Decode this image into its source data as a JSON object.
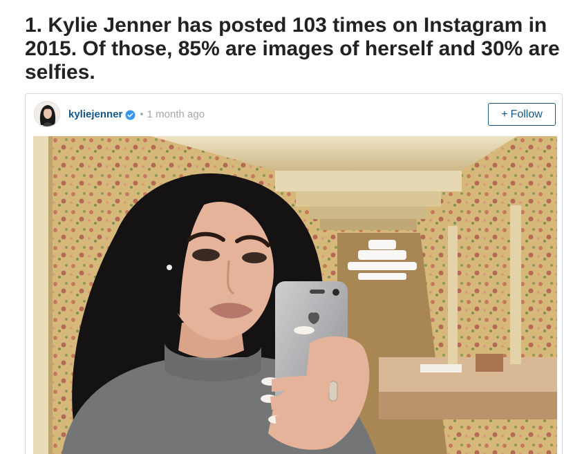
{
  "article": {
    "headline": "1. Kylie Jenner has posted 103 times on Instagram in 2015. Of those, 85% are images of herself and 30% are selfies."
  },
  "embed": {
    "username": "kyliejenner",
    "separator": "•",
    "timestamp": "1 month ago",
    "follow_plus": "+",
    "follow_label": "Follow",
    "verified_icon": "verified-badge-icon",
    "brand_color": "#125688",
    "verified_color": "#3897f0"
  }
}
